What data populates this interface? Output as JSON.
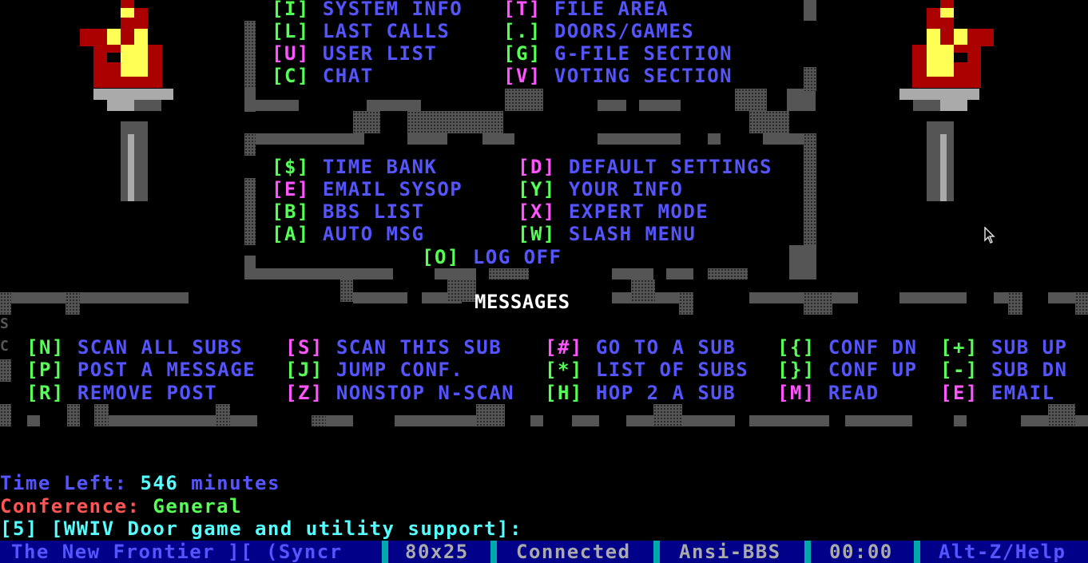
{
  "main_menu": {
    "row1": [
      {
        "key": "[I]",
        "label": "SYSTEM INFO"
      },
      {
        "key": "[T]",
        "label": "FILE AREA"
      }
    ],
    "row2": [
      {
        "key": "[L]",
        "label": "LAST CALLS"
      },
      {
        "key": "[.]",
        "label": "DOORS/GAMES"
      }
    ],
    "row3": [
      {
        "key": "[U]",
        "label": "USER LIST"
      },
      {
        "key": "[G]",
        "label": "G-FILE SECTION"
      }
    ],
    "row4": [
      {
        "key": "[C]",
        "label": "CHAT"
      },
      {
        "key": "[V]",
        "label": "VOTING SECTION"
      }
    ]
  },
  "account_menu": {
    "items": [
      {
        "key": "[$]",
        "label": "TIME BANK"
      },
      {
        "key": "[D]",
        "label": "DEFAULT SETTINGS"
      },
      {
        "key": "[E]",
        "label": "EMAIL SYSOP"
      },
      {
        "key": "[Y]",
        "label": "YOUR INFO"
      },
      {
        "key": "[B]",
        "label": "BBS LIST"
      },
      {
        "key": "[X]",
        "label": "EXPERT MODE"
      },
      {
        "key": "[A]",
        "label": "AUTO MSG"
      },
      {
        "key": "[W]",
        "label": "SLASH MENU"
      }
    ],
    "logoff": {
      "key": "[O]",
      "label": "LOG OFF"
    }
  },
  "messages": {
    "title": "MESSAGES",
    "side_letters": [
      "S",
      "C"
    ],
    "items": [
      {
        "key": "[N]",
        "label": "SCAN ALL SUBS"
      },
      {
        "key": "[S]",
        "label": "SCAN THIS SUB"
      },
      {
        "key": "[#]",
        "label": "GO TO A SUB"
      },
      {
        "key": "[{]",
        "label": "CONF DN"
      },
      {
        "key": "[+]",
        "label": "SUB UP"
      },
      {
        "key": "[P]",
        "label": "POST A MESSAGE"
      },
      {
        "key": "[J]",
        "label": "JUMP CONF."
      },
      {
        "key": "[*]",
        "label": "LIST OF SUBS"
      },
      {
        "key": "[}]",
        "label": "CONF UP"
      },
      {
        "key": "[-]",
        "label": "SUB DN"
      },
      {
        "key": "[R]",
        "label": "REMOVE POST"
      },
      {
        "key": "[Z]",
        "label": "NONSTOP N-SCAN"
      },
      {
        "key": "[H]",
        "label": "HOP 2 A SUB"
      },
      {
        "key": "[M]",
        "label": "READ"
      },
      {
        "key": "[E]",
        "label": "EMAIL"
      }
    ]
  },
  "info": {
    "time_label": "Time Left:",
    "time_value": "546",
    "time_unit": "minutes",
    "conf_label": "Conference:",
    "conf_value": "General",
    "prompt": "[5] [WWIV Door game and utility support]:"
  },
  "statusbar": {
    "title": "The New Frontier ][ (Syncr",
    "size": "80x25",
    "state": "Connected",
    "emulation": "Ansi-BBS",
    "timer": "00:00",
    "help": "Alt-Z/Help"
  },
  "colors": {
    "key": "#55ff55",
    "key_alt": "#ff55ff",
    "label": "#5555ff",
    "status_bg": "#000088",
    "status_sep": "#00aaaa"
  },
  "icons": [
    "torch-icon",
    "mouse-pointer-icon"
  ]
}
